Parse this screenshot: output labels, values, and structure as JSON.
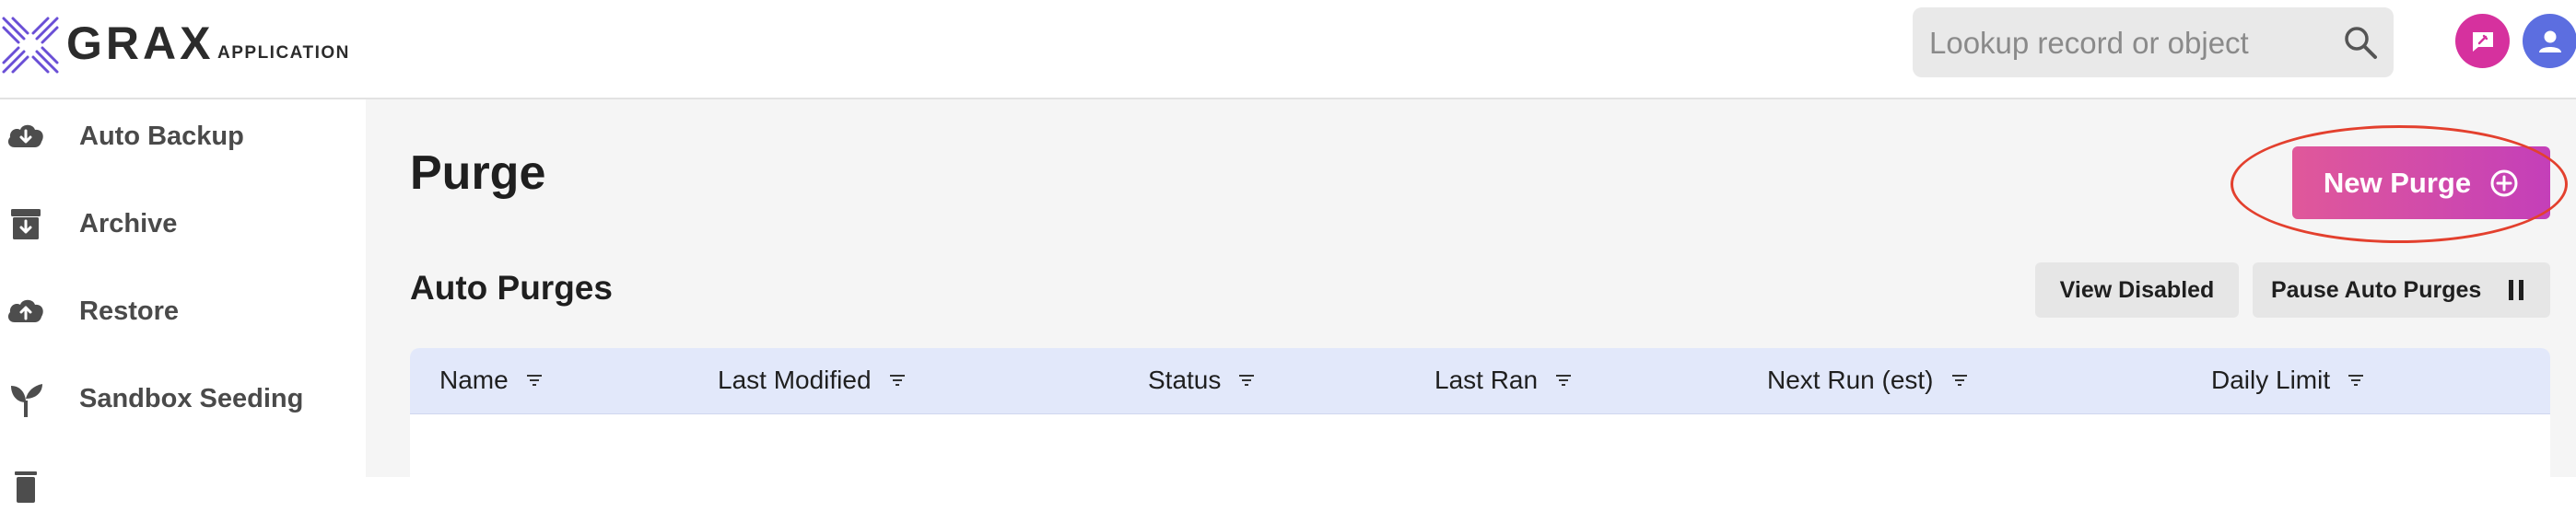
{
  "header": {
    "brand": "GRAX",
    "brand_sub": "APPLICATION",
    "search": {
      "placeholder": "Lookup record or object",
      "value": ""
    },
    "icons": [
      "logo-icon",
      "search-icon",
      "feedback-icon",
      "user-icon"
    ]
  },
  "sidebar": {
    "items": [
      {
        "label": "Auto Backup",
        "icon": "cloud-download-icon"
      },
      {
        "label": "Archive",
        "icon": "archive-box-icon"
      },
      {
        "label": "Restore",
        "icon": "cloud-upload-icon"
      },
      {
        "label": "Sandbox Seeding",
        "icon": "seedling-icon"
      },
      {
        "label": "",
        "icon": "trash-icon"
      }
    ]
  },
  "main": {
    "title": "Purge",
    "new_button": "New Purge",
    "section_title": "Auto Purges",
    "view_disabled": "View Disabled",
    "pause_auto": "Pause Auto Purges",
    "columns": [
      "Name",
      "Last Modified",
      "Status",
      "Last Ran",
      "Next Run (est)",
      "Daily Limit"
    ]
  },
  "colors": {
    "accent_gradient_start": "#e0589a",
    "accent_gradient_end": "#c43fb9",
    "feedback": "#d6319e",
    "avatar": "#5c6ee0",
    "table_header": "#e2e8fa",
    "highlight": "#e3402e"
  }
}
